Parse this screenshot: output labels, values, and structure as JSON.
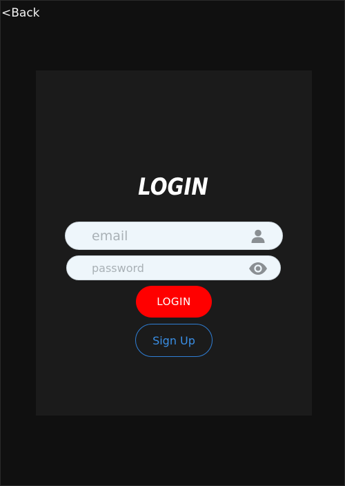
{
  "nav": {
    "back_label": "<Back"
  },
  "login": {
    "title": "LOGIN",
    "email": {
      "value": "",
      "placeholder": "email",
      "icon": "person-icon"
    },
    "password": {
      "value": "",
      "placeholder": "password",
      "icon": "eye-icon"
    },
    "login_button_label": "LOGIN",
    "signup_button_label": "Sign Up"
  },
  "colors": {
    "background": "#101010",
    "card": "#1b1b1b",
    "input_bg": "#eef6fb",
    "icon_gray": "#8a8f93",
    "login_red": "#ff0000",
    "signup_blue": "#2f7fd6"
  }
}
